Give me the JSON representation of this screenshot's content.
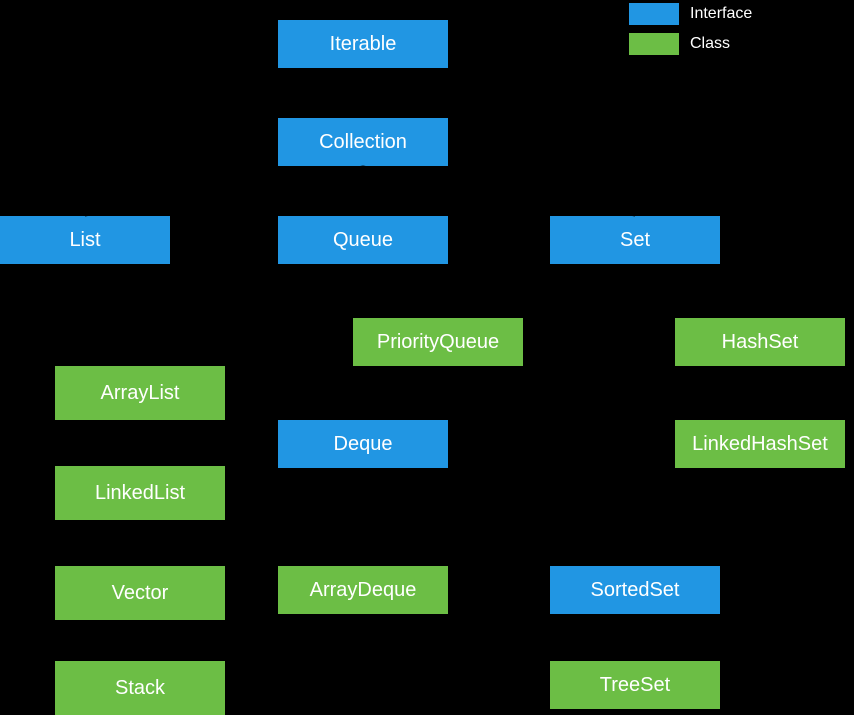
{
  "legend": {
    "interface": "Interface",
    "class": "Class"
  },
  "nodes": {
    "iterable": "Iterable",
    "collection": "Collection",
    "list": "List",
    "queue": "Queue",
    "set": "Set",
    "arraylist": "ArrayList",
    "linkedlist": "LinkedList",
    "vector": "Vector",
    "stack": "Stack",
    "priorityqueue": "PriorityQueue",
    "deque": "Deque",
    "arraydeque": "ArrayDeque",
    "hashset": "HashSet",
    "linkedhashset": "LinkedHashSet",
    "sortedset": "SortedSet",
    "treeset": "TreeSet"
  },
  "colors": {
    "interface": "#2196E3",
    "class": "#6CBE45"
  }
}
